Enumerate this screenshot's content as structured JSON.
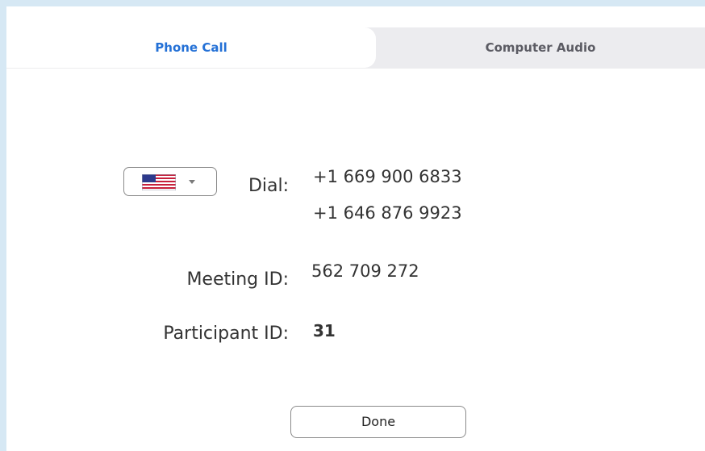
{
  "tabs": {
    "phone_call": "Phone Call",
    "computer_audio": "Computer Audio"
  },
  "country_select": {
    "selected_icon": "us-flag-icon"
  },
  "dial": {
    "label": "Dial:",
    "numbers": [
      "+1 669 900 6833",
      "+1 646 876 9923"
    ]
  },
  "meeting": {
    "label": "Meeting ID:",
    "value": "562 709 272"
  },
  "participant": {
    "label": "Participant ID:",
    "value": "31"
  },
  "done_label": "Done",
  "colors": {
    "accent": "#2370d6",
    "window_border": "#d6e8f4",
    "tab_bar": "#ececef"
  }
}
